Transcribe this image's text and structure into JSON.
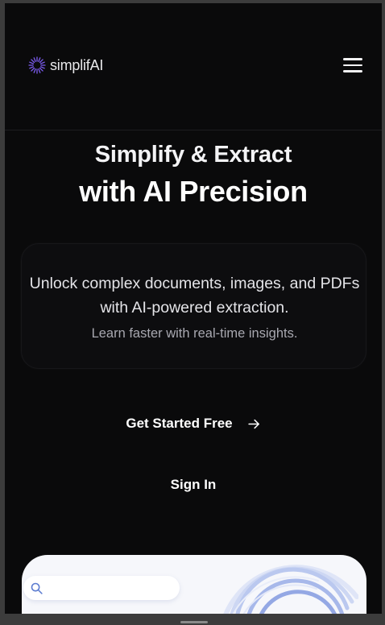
{
  "header": {
    "logo_text": "simplifAI",
    "logo_icon": "sunburst-logo-icon",
    "menu_icon": "hamburger-menu-icon"
  },
  "hero": {
    "line1": "Simplify & Extract",
    "line2": "with AI Precision"
  },
  "card": {
    "text": "Unlock complex documents, images, and PDFs with AI-powered extraction.",
    "subtext": "Learn faster with real-time insights."
  },
  "actions": {
    "get_started_label": "Get Started Free",
    "get_started_icon": "arrow-right-icon",
    "sign_in_label": "Sign In"
  },
  "preview": {
    "search_icon": "search-icon"
  },
  "colors": {
    "background": "#0a0a0b",
    "accent": "#7c5cf0",
    "preview_bg": "#f6f7fb",
    "preview_accent": "#7b93d9"
  }
}
